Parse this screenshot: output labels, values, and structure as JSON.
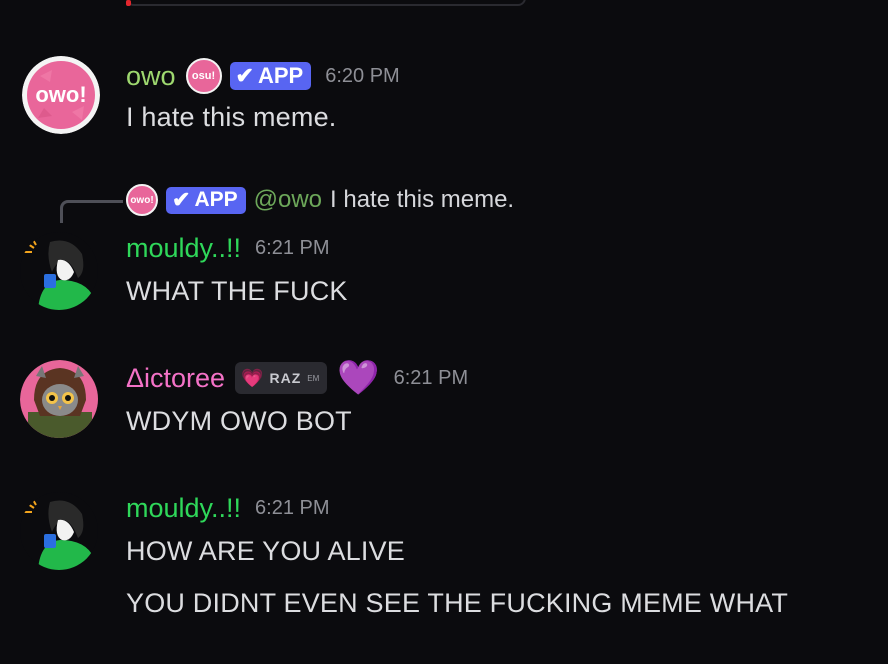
{
  "messages": [
    {
      "author": "owo",
      "author_color": "#9ed86f",
      "badge_icon_text": "osu!",
      "app_badge": "APP",
      "time": "6:20 PM",
      "avatar_text": "owo!",
      "lines": [
        "I hate this meme."
      ]
    },
    {
      "reply": {
        "icon_text": "owo!",
        "app_badge": "APP",
        "mention": "@owo",
        "text": "I hate this meme."
      },
      "author": "mouldy..!!",
      "author_color": "#2fd85a",
      "time": "6:21 PM",
      "lines": [
        "WHAT THE FUCK"
      ]
    },
    {
      "author": "Δictoree",
      "author_color": "#f472c7",
      "tag": "RAZ",
      "tag_small": "EM",
      "time": "6:21 PM",
      "lines": [
        "WDYM OWO BOT"
      ]
    },
    {
      "author": "mouldy..!!",
      "author_color": "#2fd85a",
      "time": "6:21 PM",
      "lines": [
        "HOW ARE YOU ALIVE",
        "YOU DIDNT EVEN SEE THE FUCKING MEME WHAT"
      ]
    }
  ],
  "colors": {
    "background": "#0b0b0e",
    "app_badge": "#5865f2",
    "mention": "#6da85a"
  },
  "icons": [
    "check-icon",
    "heart-icon"
  ]
}
